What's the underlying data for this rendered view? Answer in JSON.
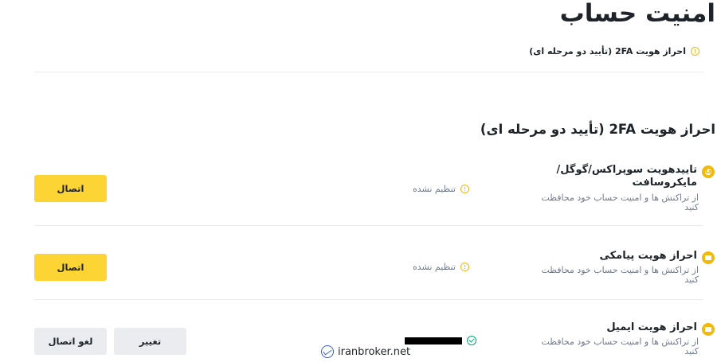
{
  "page": {
    "title": "امنیت حساب",
    "notice": "احراز هویت 2FA (تأیید دو مرحله ای)"
  },
  "section": {
    "title": "احراز هویت 2FA (تأیید دو مرحله ای)"
  },
  "methods": [
    {
      "title": "تاییدهویت سوپراکس/گوگل/مایکروسافت",
      "description": "از تراکنش ها و امنیت حساب خود محافظت کنید",
      "status": "تنظیم نشده",
      "button": "اتصال",
      "icon": "google-authenticator-icon"
    },
    {
      "title": "احراز هویت پیامکی",
      "description": "از تراکنش ها و امنیت حساب خود محافظت کنید",
      "status": "تنظیم نشده",
      "button": "اتصال",
      "icon": "sms-icon"
    },
    {
      "title": "احراز هویت ایمیل",
      "description": "از تراکنش ها و امنیت حساب خود محافظت کنید",
      "change_button": "تغییر",
      "disconnect_button": "لغو اتصال",
      "icon": "email-icon"
    }
  ],
  "watermark": {
    "text": "iranbroker.net"
  },
  "colors": {
    "accent": "#fcd535",
    "icon_accent": "#f0b90b",
    "success": "#03a66d",
    "muted_text": "#707a8a"
  }
}
